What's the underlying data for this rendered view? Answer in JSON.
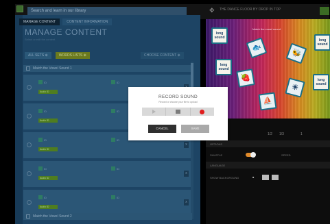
{
  "top_bar": {
    "search_placeholder": "Search and learn in our library",
    "app_title": "THE DANCE FLOOR BY DROP IN TOP"
  },
  "left_panel": {
    "tabs": [
      {
        "label": "MANAGE CONTENT",
        "active": true
      },
      {
        "label": "CONTENT INFORMATION",
        "active": false
      }
    ],
    "title": "MANAGE CONTENT",
    "subtitle": "Select or edit the content",
    "filters": [
      {
        "label": "ALL SETS ⊕"
      },
      {
        "label": "WORDS LISTS ⊕"
      }
    ],
    "filter_right": "CHOOSE CONTENT ⊕",
    "set_header": "Match the Vowel Sound 1",
    "rows": [
      {
        "left_label": "ID",
        "right_label": "ID",
        "badge": "Audio ID"
      },
      {
        "left_label": "ID",
        "right_label": "ID",
        "badge": "Audio ID"
      },
      {
        "left_label": "ID",
        "right_label": "ID",
        "badge": "Audio ID"
      },
      {
        "left_label": "ID",
        "right_label": "ID",
        "badge": "Audio ID"
      },
      {
        "left_label": "ID",
        "right_label": "ID",
        "badge": "Audio ID"
      }
    ],
    "remove_glyph": "x",
    "bottom_set_header": "Match the Vowel Sound 2"
  },
  "preview": {
    "label": "Match the vowel sound",
    "tiles": [
      {
        "text": "long\nsound",
        "glyph": ""
      },
      {
        "text": "",
        "glyph": "🐟"
      },
      {
        "text": "",
        "glyph": "🐝"
      },
      {
        "text": "long\nsound",
        "glyph": ""
      },
      {
        "text": "long\nsound",
        "glyph": ""
      },
      {
        "text": "",
        "glyph": "🍓"
      },
      {
        "text": "",
        "glyph": "☀"
      },
      {
        "text": "long\nsound",
        "glyph": ""
      },
      {
        "text": "",
        "glyph": "⛵"
      },
      {
        "text": "",
        "glyph": "🔑"
      }
    ]
  },
  "right_panel": {
    "row1_label": "TILE SIZE",
    "row1_values": [
      "1/2",
      "1/3",
      "1"
    ],
    "section1": "OPTIONS",
    "toggle_label": "SHUFFLE",
    "toggle_label2": "SPEED",
    "section2": "LANGUAGE",
    "bg_label": "SHOW BACKGROUND"
  },
  "modal": {
    "title": "RECORD SOUND",
    "subtitle": "Record or choose your file to upload",
    "cancel_label": "CANCEL",
    "save_label": "SAVE"
  },
  "colors": {
    "record_red": "#e01d1d",
    "cancel_dark": "#2f2f2f",
    "save_gray": "#a9a9a9"
  }
}
